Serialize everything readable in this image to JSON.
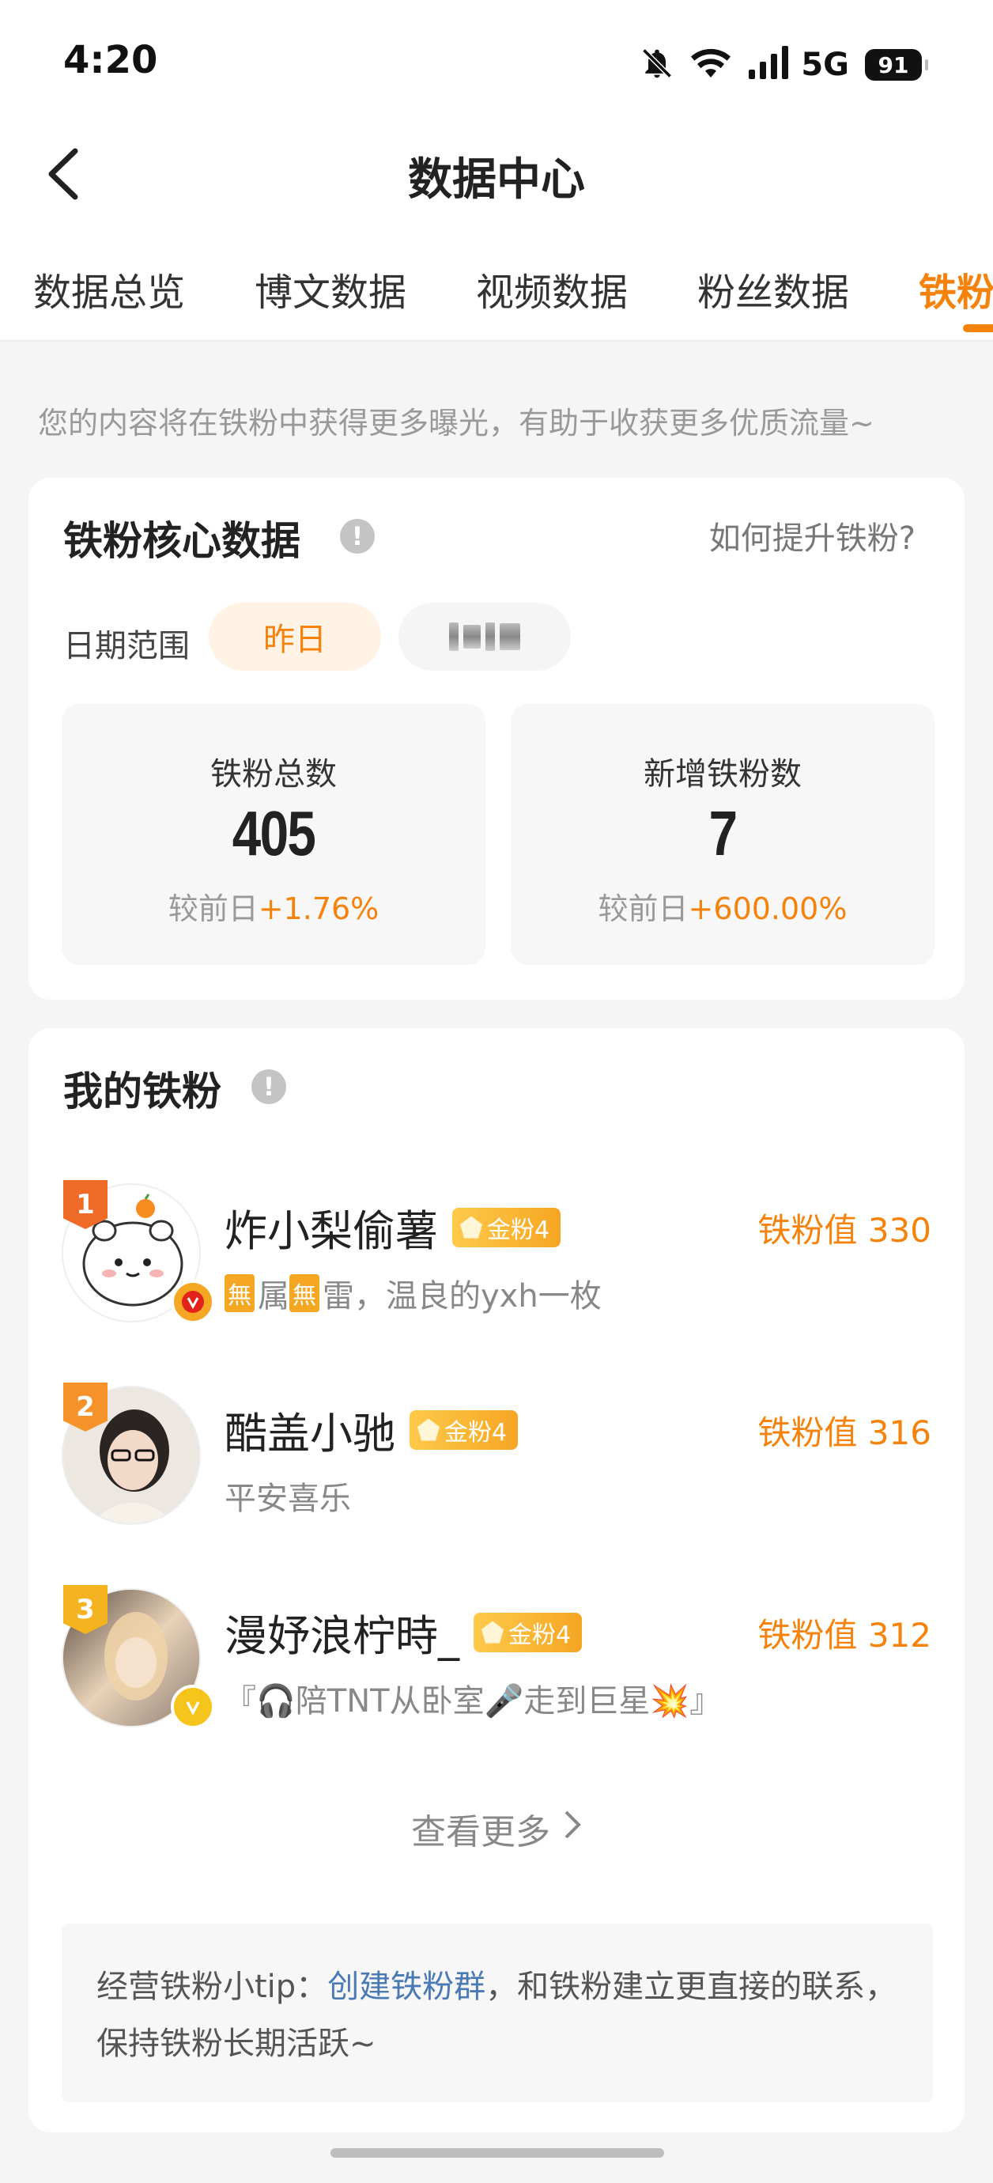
{
  "status_bar": {
    "time": "4:20",
    "network": "5G",
    "battery": "91",
    "icons": [
      "bell-muted-icon",
      "wifi-icon",
      "signal-icon",
      "battery-icon"
    ]
  },
  "nav": {
    "title": "数据中心",
    "back_icon": "chevron-left-icon"
  },
  "tabs": [
    {
      "label": "数据总览",
      "active": false
    },
    {
      "label": "博文数据",
      "active": false
    },
    {
      "label": "视频数据",
      "active": false
    },
    {
      "label": "粉丝数据",
      "active": false
    },
    {
      "label": "铁粉",
      "active": true
    }
  ],
  "hint": "您的内容将在铁粉中获得更多曝光，有助于收获更多优质流量~",
  "core": {
    "title": "铁粉核心数据",
    "info_icon": "!",
    "help_link": "如何提升铁粉?",
    "date_range_label": "日期范围",
    "date_options": [
      "昨日"
    ],
    "stats": [
      {
        "label": "铁粉总数",
        "value": "405",
        "compare_label": "较前日",
        "change": "+1.76%"
      },
      {
        "label": "新增铁粉数",
        "value": "7",
        "compare_label": "较前日",
        "change": "+600.00%"
      }
    ]
  },
  "my_fans": {
    "title": "我的铁粉",
    "info_icon": "!",
    "fans": [
      {
        "rank": "1",
        "name": "炸小梨偷薯",
        "level": "金粉4",
        "value": "铁粉值 330",
        "bio_tag": "無",
        "bio_parts": [
          "属",
          "雷，温良的yxh一枚"
        ],
        "verified_color": "#f5a623"
      },
      {
        "rank": "2",
        "name": "酷盖小驰",
        "level": "金粉4",
        "value": "铁粉值 316",
        "bio": "平安喜乐"
      },
      {
        "rank": "3",
        "name": "漫妤浪柠時_",
        "level": "金粉4",
        "value": "铁粉值 312",
        "bio": "『🎧陪TNT从卧室🎤走到巨星💥』",
        "verified_color": "#f5c51b"
      }
    ],
    "more_label": "查看更多",
    "tip_prefix": "经营铁粉小tip：",
    "tip_link": "创建铁粉群",
    "tip_suffix": "，和铁粉建立更直接的联系，保持铁粉长期活跃~"
  },
  "colors": {
    "accent": "#f5820b",
    "badge_gold": "#f5a623",
    "link_blue": "#4a7ab5"
  }
}
